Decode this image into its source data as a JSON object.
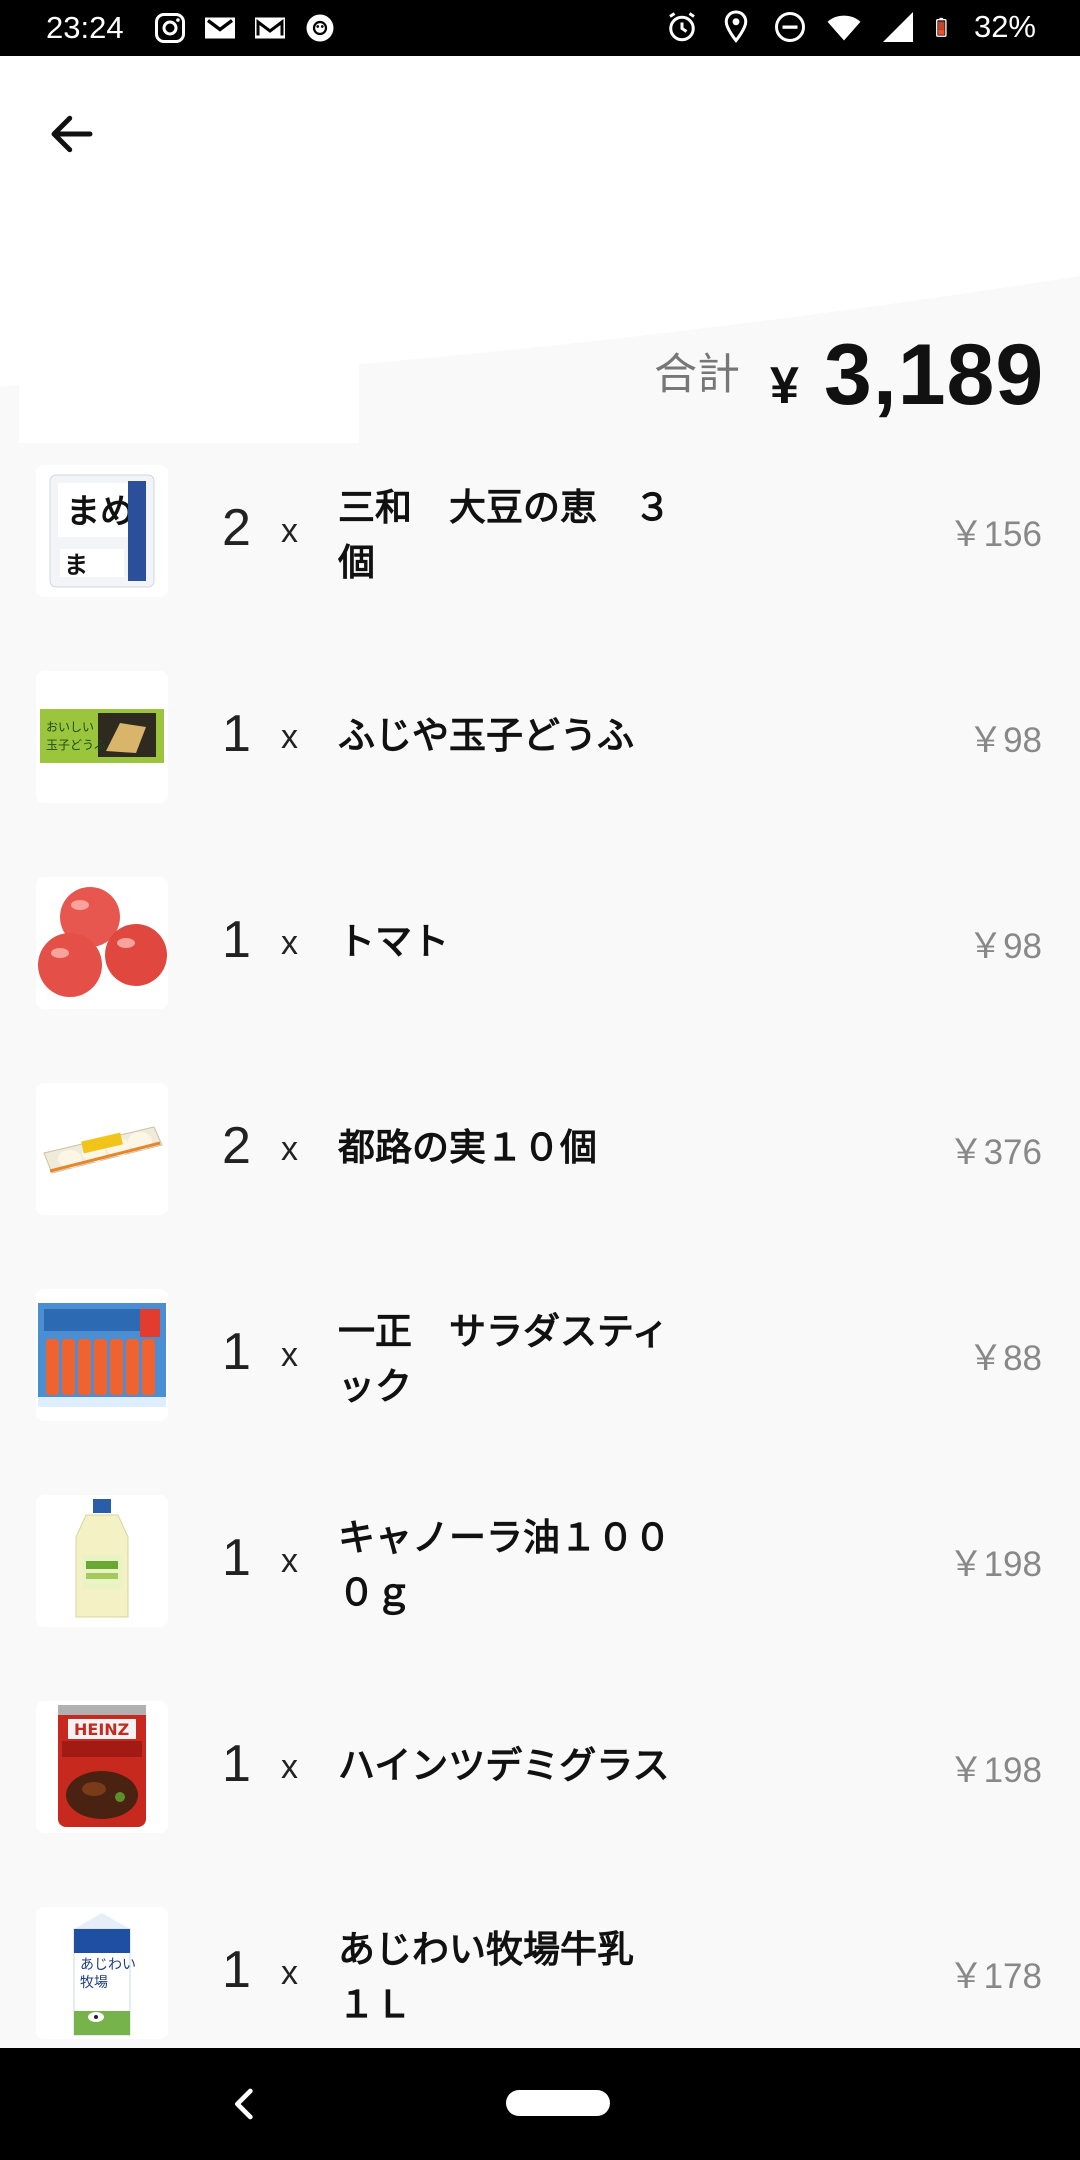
{
  "status_bar": {
    "time": "23:24",
    "battery": "32%",
    "left_icons": [
      "instagram-icon",
      "gmail-icon",
      "gmail-icon",
      "settings-flower-icon"
    ],
    "right_icons": [
      "alarm-icon",
      "location-icon",
      "dnd-icon",
      "wifi-icon",
      "signal-icon",
      "battery-icon"
    ]
  },
  "header": {
    "back_icon": "arrow-left-icon",
    "total_label": "合計",
    "currency": "¥",
    "total_amount": "3,189"
  },
  "items": [
    {
      "qty": "2",
      "times": "x",
      "name": "三和　大豆の恵　３個",
      "price": "￥156",
      "thumb_icon": "natto-pack-icon"
    },
    {
      "qty": "1",
      "times": "x",
      "name": "ふじや玉子どうふ",
      "price": "￥98",
      "thumb_icon": "tofu-pack-icon"
    },
    {
      "qty": "1",
      "times": "x",
      "name": "トマト",
      "price": "￥98",
      "thumb_icon": "tomato-icon"
    },
    {
      "qty": "2",
      "times": "x",
      "name": "都路の実１０個",
      "price": "￥376",
      "thumb_icon": "egg-pack-icon"
    },
    {
      "qty": "1",
      "times": "x",
      "name": "一正　サラダスティック",
      "price": "￥88",
      "thumb_icon": "crab-stick-icon"
    },
    {
      "qty": "1",
      "times": "x",
      "name": "キャノーラ油１０００ｇ",
      "price": "￥198",
      "thumb_icon": "oil-bottle-icon"
    },
    {
      "qty": "1",
      "times": "x",
      "name": "ハインツデミグラス",
      "price": "￥198",
      "thumb_icon": "sauce-can-icon"
    },
    {
      "qty": "1",
      "times": "x",
      "name": "あじわい牧場牛乳　１Ｌ",
      "price": "￥178",
      "thumb_icon": "milk-carton-icon"
    }
  ],
  "nav_bar": {
    "back_icon": "nav-back-icon",
    "home_icon": "home-pill-icon"
  },
  "colors": {
    "background": "#f9f9f9",
    "header": "#ffffff",
    "text_primary": "#111111",
    "text_secondary": "#888888",
    "bars": "#000000"
  }
}
